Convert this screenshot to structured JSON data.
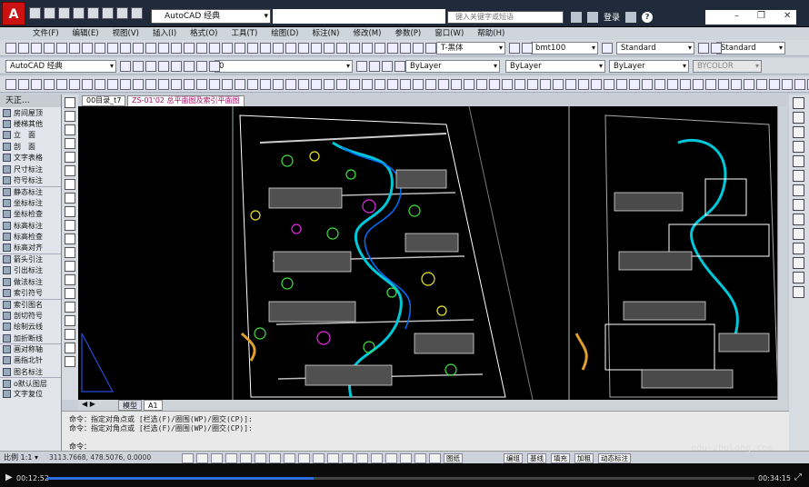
{
  "title": {
    "app_button": "A",
    "workspace": "AutoCAD 经典",
    "search_placeholder": "键入关键字或短语",
    "login": "登录",
    "help": "?"
  },
  "menu": [
    "文件(F)",
    "编辑(E)",
    "视图(V)",
    "插入(I)",
    "格式(O)",
    "工具(T)",
    "绘图(D)",
    "标注(N)",
    "修改(M)",
    "参数(P)",
    "窗口(W)",
    "帮助(H)"
  ],
  "toolbar": {
    "text_style": "T-黑体",
    "dim_style": "bmt100",
    "table_style": "Standard",
    "multileader_style": "Standard",
    "workspace_combo": "AutoCAD 经典",
    "layer": "0",
    "color": "ByLayer",
    "linetype": "ByLayer",
    "lineweight": "ByLayer",
    "plotstyle": "BYCOLOR"
  },
  "left_palette": {
    "header": "天正...",
    "items": [
      {
        "label": "房间屋顶",
        "icon": "room-roof-icon"
      },
      {
        "label": "楼梯其他",
        "icon": "stairs-icon"
      },
      {
        "label": "立　面",
        "icon": "elevation-icon"
      },
      {
        "label": "剖　面",
        "icon": "section-icon"
      },
      {
        "label": "文字表格",
        "icon": "text-table-icon"
      },
      {
        "label": "尺寸标注",
        "icon": "dimension-icon"
      },
      {
        "label": "符号标注",
        "icon": "symbol-icon"
      },
      {
        "label": "静态标注",
        "icon": "static-annot-icon",
        "sec": true
      },
      {
        "label": "坐标标注",
        "icon": "coord-annot-icon"
      },
      {
        "label": "坐标检查",
        "icon": "coord-check-icon"
      },
      {
        "label": "标高标注",
        "icon": "elev-annot-icon"
      },
      {
        "label": "标高检查",
        "icon": "elev-check-icon"
      },
      {
        "label": "标高对齐",
        "icon": "elev-align-icon"
      },
      {
        "label": "箭头引注",
        "icon": "arrow-note-icon",
        "sec": true
      },
      {
        "label": "引出标注",
        "icon": "leader-icon"
      },
      {
        "label": "做法标注",
        "icon": "method-icon"
      },
      {
        "label": "索引符号",
        "icon": "index-symbol-icon"
      },
      {
        "label": "索引图名",
        "icon": "index-name-icon",
        "sec": true
      },
      {
        "label": "剖切符号",
        "icon": "cut-symbol-icon"
      },
      {
        "label": "绘制云线",
        "icon": "cloud-icon"
      },
      {
        "label": "加折断线",
        "icon": "break-line-icon"
      },
      {
        "label": "画对称轴",
        "icon": "symmetry-icon",
        "sec": true
      },
      {
        "label": "画指北针",
        "icon": "north-arrow-icon"
      },
      {
        "label": "图名标注",
        "icon": "drawing-name-icon"
      },
      {
        "label": "o默认图层",
        "icon": "default-layer-icon",
        "sec": true
      },
      {
        "label": "文字复位",
        "icon": "text-reset-icon"
      }
    ]
  },
  "tabs": [
    {
      "label": "00目录_t7"
    },
    {
      "label": "ZS-01'02 总平面图及索引平面图",
      "active": true
    }
  ],
  "layout_tabs": [
    "模型",
    "A1"
  ],
  "command": {
    "line1": "命令：指定对角点或 [栏选(F)/圈围(WP)/圈交(CP)]:",
    "line2": "命令：指定对角点或 [栏选(F)/圈围(WP)/圈交(CP)]:",
    "prompt": "命令："
  },
  "status": {
    "scale": "比例 1:1 ▾",
    "coords": "3113.7668, 478.5076, 0.0000",
    "buttons": [
      "图纸",
      "编组",
      "基线",
      "填充",
      "加粗",
      "动态标注"
    ]
  },
  "watermark": "edu-zhulong.com",
  "player": {
    "current": "00:12:52",
    "duration": "00:34:15",
    "progress": 0.376
  },
  "colors": {
    "titlebar": "#1f2a3a",
    "canvas": "#000000",
    "accent_red": "#cc1111"
  }
}
